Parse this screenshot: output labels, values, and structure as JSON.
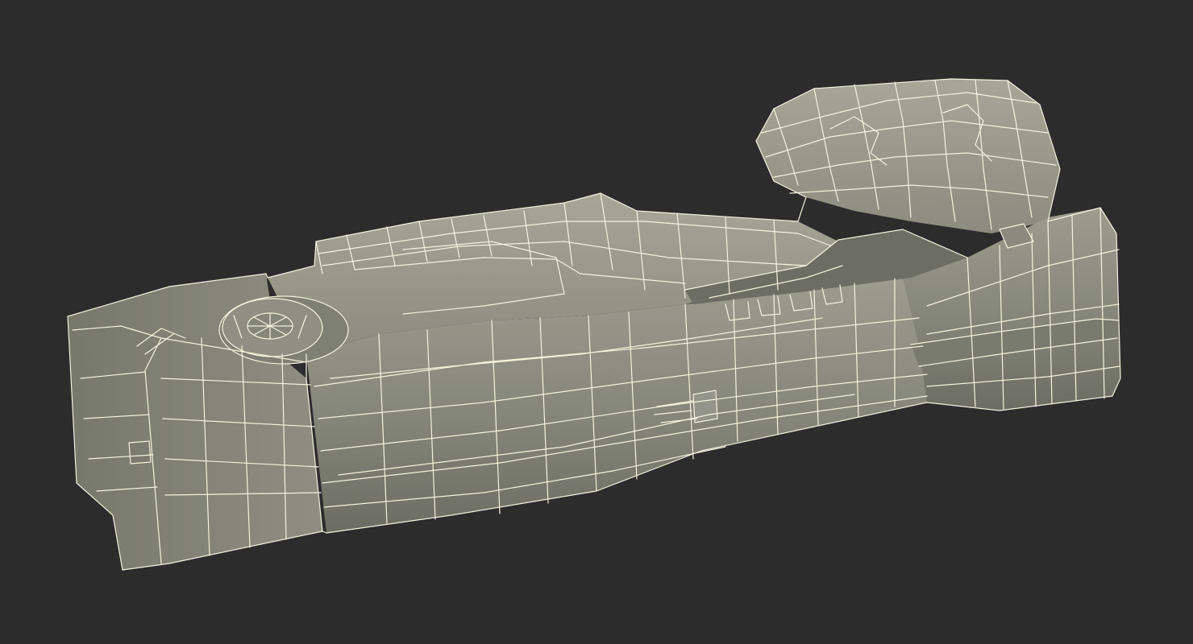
{
  "scene": {
    "background_color": "#2c2c2c",
    "model": {
      "subject": "wireframe-3d-model",
      "render_style": "wireframe-over-shaded",
      "surface_color": "#8a8b7e",
      "surface_dark": "#6f7065",
      "surface_light": "#a3a496",
      "wire_color": "#f4f2df"
    }
  }
}
